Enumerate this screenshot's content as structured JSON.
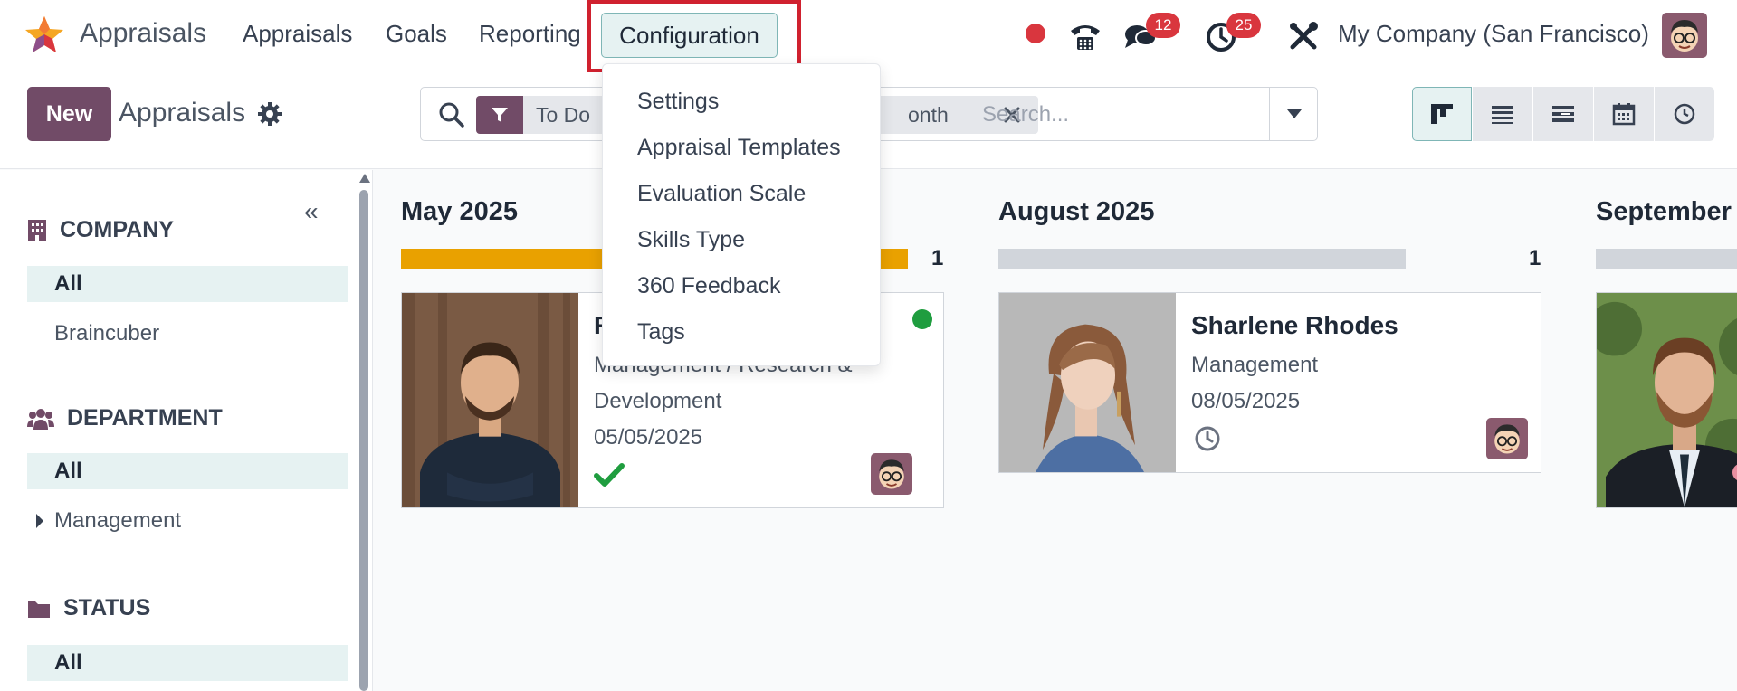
{
  "navbar": {
    "app_name": "Appraisals",
    "menu": [
      "Appraisals",
      "Goals",
      "Reporting"
    ],
    "active_menu": "Configuration",
    "messages_badge": "12",
    "activities_badge": "25",
    "company": "My Company (San Francisco)"
  },
  "configuration_menu": {
    "items": [
      "Settings",
      "Appraisal Templates",
      "Evaluation Scale",
      "Skills Type",
      "360 Feedback",
      "Tags"
    ]
  },
  "control_panel": {
    "new_label": "New",
    "title": "Appraisals",
    "facets": [
      "To Do",
      "onth"
    ],
    "search_placeholder": "Search..."
  },
  "sidebar": {
    "sections": [
      {
        "header": "COMPANY",
        "values": [
          "All",
          "Braincuber"
        ]
      },
      {
        "header": "DEPARTMENT",
        "values": [
          "All",
          "Management"
        ]
      },
      {
        "header": "STATUS",
        "values": [
          "All"
        ]
      }
    ]
  },
  "kanban": {
    "columns": [
      {
        "title": "May 2025",
        "count": "1",
        "progress_fraction": 1.0,
        "card": {
          "name": "R",
          "department_line1": "Management / Research &",
          "department_line2": "Development",
          "date": "05/05/2025"
        }
      },
      {
        "title": "August 2025",
        "count": "1",
        "progress_fraction": 0.0,
        "card": {
          "name": "Sharlene Rhodes",
          "department_line1": "Management",
          "date": "08/05/2025"
        }
      },
      {
        "title": "September",
        "count": "",
        "progress_fraction": 0.0
      }
    ]
  },
  "colors": {
    "brand": "#714b67",
    "accent": "#e6f2f2",
    "progress": "#e9a100",
    "highlight": "#d0212f",
    "badge": "#d9363e",
    "done": "#1f9d3f"
  }
}
